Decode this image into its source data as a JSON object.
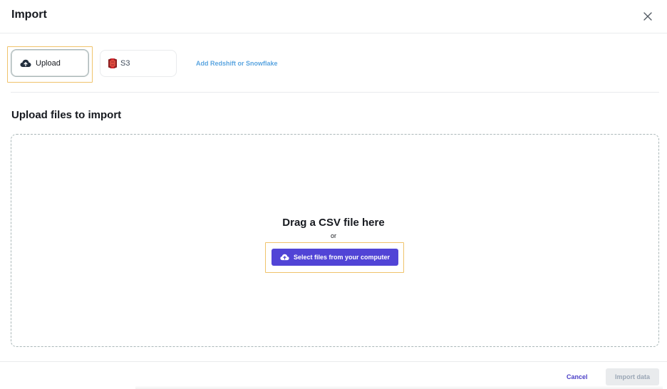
{
  "dialog": {
    "title": "Import",
    "close_icon": "close-icon"
  },
  "sources": {
    "upload_label": "Upload",
    "upload_icon": "cloud-upload-icon",
    "s3_label": "S3",
    "s3_icon": "s3-bucket-icon",
    "add_link": "Add Redshift or Snowflake"
  },
  "upload_section": {
    "title": "Upload files to import",
    "drop_title": "Drag a CSV file here",
    "or_text": "or",
    "select_button": "Select files from your computer"
  },
  "footer": {
    "cancel_label": "Cancel",
    "import_label": "Import data"
  },
  "colors": {
    "primary": "#5144d6",
    "link": "#5ba5e0",
    "highlight": "#f0c36b",
    "s3_red": "#d6232c"
  }
}
